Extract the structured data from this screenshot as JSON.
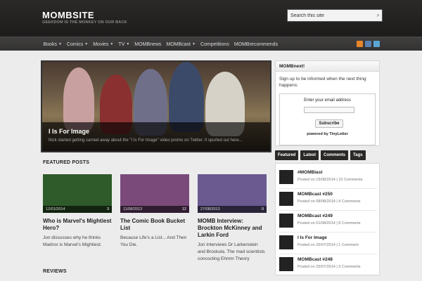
{
  "site": {
    "title": "MOMBSITE",
    "tagline": "GEEKDOM IS THE MONKEY ON OUR BACK"
  },
  "search": {
    "placeholder": "Search this site",
    "icon": "search-icon"
  },
  "nav": {
    "items": [
      {
        "label": "Books",
        "dropdown": true
      },
      {
        "label": "Comics",
        "dropdown": true
      },
      {
        "label": "Movies",
        "dropdown": true
      },
      {
        "label": "TV",
        "dropdown": true
      },
      {
        "label": "MOMBnews",
        "dropdown": false
      },
      {
        "label": "MOMBcast",
        "dropdown": true
      },
      {
        "label": "Competitions",
        "dropdown": false
      },
      {
        "label": "MOMBrecommends",
        "dropdown": false
      }
    ],
    "social": [
      {
        "name": "rss-icon",
        "color": "#e8852b"
      },
      {
        "name": "facebook-icon",
        "color": "#5a7fb0"
      },
      {
        "name": "twitter-icon",
        "color": "#5aa7d4"
      }
    ]
  },
  "slider": {
    "title": "I Is For Image",
    "text": "Nick started getting carried away about the \"I Is For Image\" video promo on Twitter. It spurted out here..."
  },
  "featured": {
    "heading": "FEATURED POSTS",
    "posts": [
      {
        "date": "12/01/2014",
        "comments": "3",
        "title": "Who is Marvel's Mightiest Hero?",
        "excerpt": "Jon discusses why he thinks Madrox is Marvel's Mightiest.",
        "color": "#2f5a2a"
      },
      {
        "date": "11/08/2013",
        "comments": "12",
        "title": "The Comic Book Bucket List",
        "excerpt": "Because Life's a List... And Then You Die.",
        "color": "#7a4a7a"
      },
      {
        "date": "27/08/2013",
        "comments": "0",
        "title": "MOMB Interview: Brockton McKinney and Larkin Ford",
        "excerpt": "Jon Interviews Dr Larkenstein and Brockula. The mad scientists concocting Ehmm Theory",
        "color": "#6a5a90"
      }
    ]
  },
  "reviews": {
    "heading": "REVIEWS"
  },
  "signup": {
    "heading": "MOMBnext!",
    "text": "Sign up to be informed when the next thing happens:",
    "label": "Enter your email address",
    "button": "Subscribe",
    "powered": "powered by TinyLetter"
  },
  "tabs": [
    "Featured",
    "Latest",
    "Comments",
    "Tags"
  ],
  "recent": [
    {
      "title": "#MOMBlast",
      "meta": "Posted on 15/08/2014 | 10 Comments"
    },
    {
      "title": "MOMBcast #250",
      "meta": "Posted on 08/08/2014 | 4 Comments"
    },
    {
      "title": "MOMBcast #249",
      "meta": "Posted on 01/08/2014 | 8 Comments"
    },
    {
      "title": "I Is For Image",
      "meta": "Posted on 25/07/2014 | 1 Comment"
    },
    {
      "title": "MOMBcast #248",
      "meta": "Posted on 25/07/2014 | 3 Comments"
    }
  ]
}
